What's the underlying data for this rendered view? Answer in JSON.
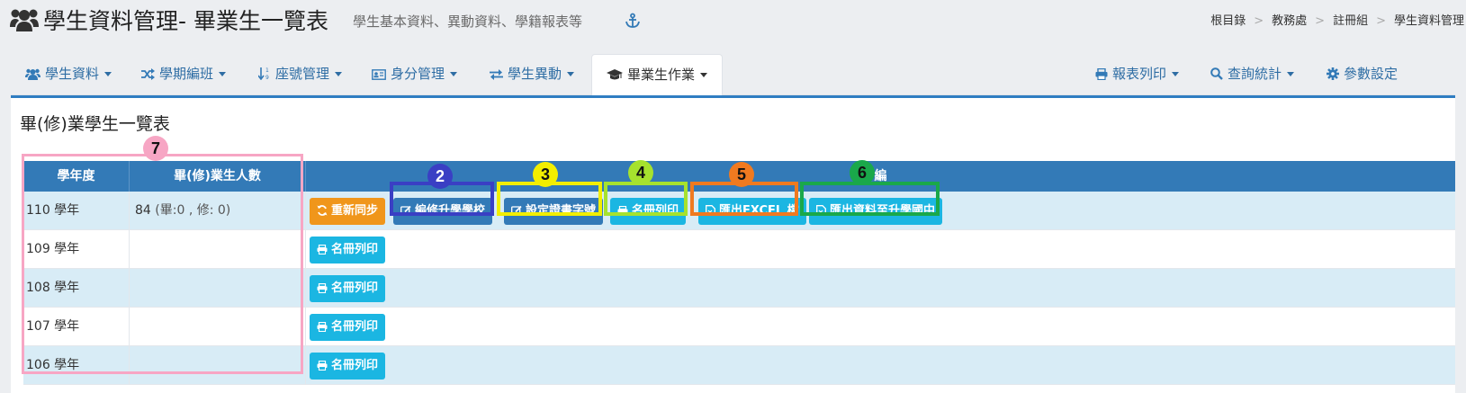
{
  "header": {
    "title": "學生資料管理- 畢業生一覽表",
    "subtitle": "學生基本資料、異動資料、學籍報表等",
    "breadcrumb": [
      "根目錄",
      "教務處",
      "註冊組",
      "學生資料管理"
    ]
  },
  "tabs": [
    {
      "label": "學生資料",
      "icon": "users-icon"
    },
    {
      "label": "學期編班",
      "icon": "shuffle-icon"
    },
    {
      "label": "座號管理",
      "icon": "sort-numeric-icon"
    },
    {
      "label": "身分管理",
      "icon": "id-card-icon"
    },
    {
      "label": "學生異動",
      "icon": "exchange-icon"
    },
    {
      "label": "畢業生作業",
      "icon": "graduation-cap-icon",
      "active": true
    },
    {
      "label": "報表列印",
      "icon": "print-icon"
    },
    {
      "label": "查詢統計",
      "icon": "search-icon"
    },
    {
      "label": "參數設定",
      "icon": "gear-icon"
    }
  ],
  "panel": {
    "title": "畢(修)業學生一覽表",
    "columns": [
      "學年度",
      "畢(修)業生人數",
      "編"
    ]
  },
  "rows": [
    {
      "year": "110 學年",
      "count_main": "84",
      "count_detail": "(畢:0 , 修: 0)"
    },
    {
      "year": "109 學年",
      "count_main": "",
      "count_detail": ""
    },
    {
      "year": "108 學年",
      "count_main": "",
      "count_detail": ""
    },
    {
      "year": "107 學年",
      "count_main": "",
      "count_detail": ""
    },
    {
      "year": "106 學年",
      "count_main": "",
      "count_detail": ""
    }
  ],
  "actions_first_row": [
    {
      "label": "重新同步",
      "icon": "refresh-icon",
      "style": "orange"
    },
    {
      "label": "編修升學學校",
      "icon": "edit-icon",
      "style": "blue"
    },
    {
      "label": "設定證書字號",
      "icon": "edit-icon",
      "style": "blue"
    },
    {
      "label": "名冊列印",
      "icon": "print-icon",
      "style": "cyan"
    },
    {
      "label": "匯出EXCEL 檔",
      "icon": "file-icon",
      "style": "cyan"
    },
    {
      "label": "匯出資料至升學國中",
      "icon": "file-icon",
      "style": "cyan"
    }
  ],
  "action_other_rows": {
    "label": "名冊列印",
    "icon": "print-icon"
  },
  "annotations": [
    {
      "number": "2",
      "color": "#3a3fc4"
    },
    {
      "number": "3",
      "color": "#f2ee00"
    },
    {
      "number": "4",
      "color": "#a6e22e"
    },
    {
      "number": "5",
      "color": "#f07a20"
    },
    {
      "number": "6",
      "color": "#1aa84a"
    },
    {
      "number": "7",
      "color": "#f7a6c4"
    }
  ],
  "colors": {
    "accent": "#337ab7",
    "orange": "#f0961b",
    "cyan": "#1bb6e2",
    "row_alt": "#d8ecf6"
  }
}
